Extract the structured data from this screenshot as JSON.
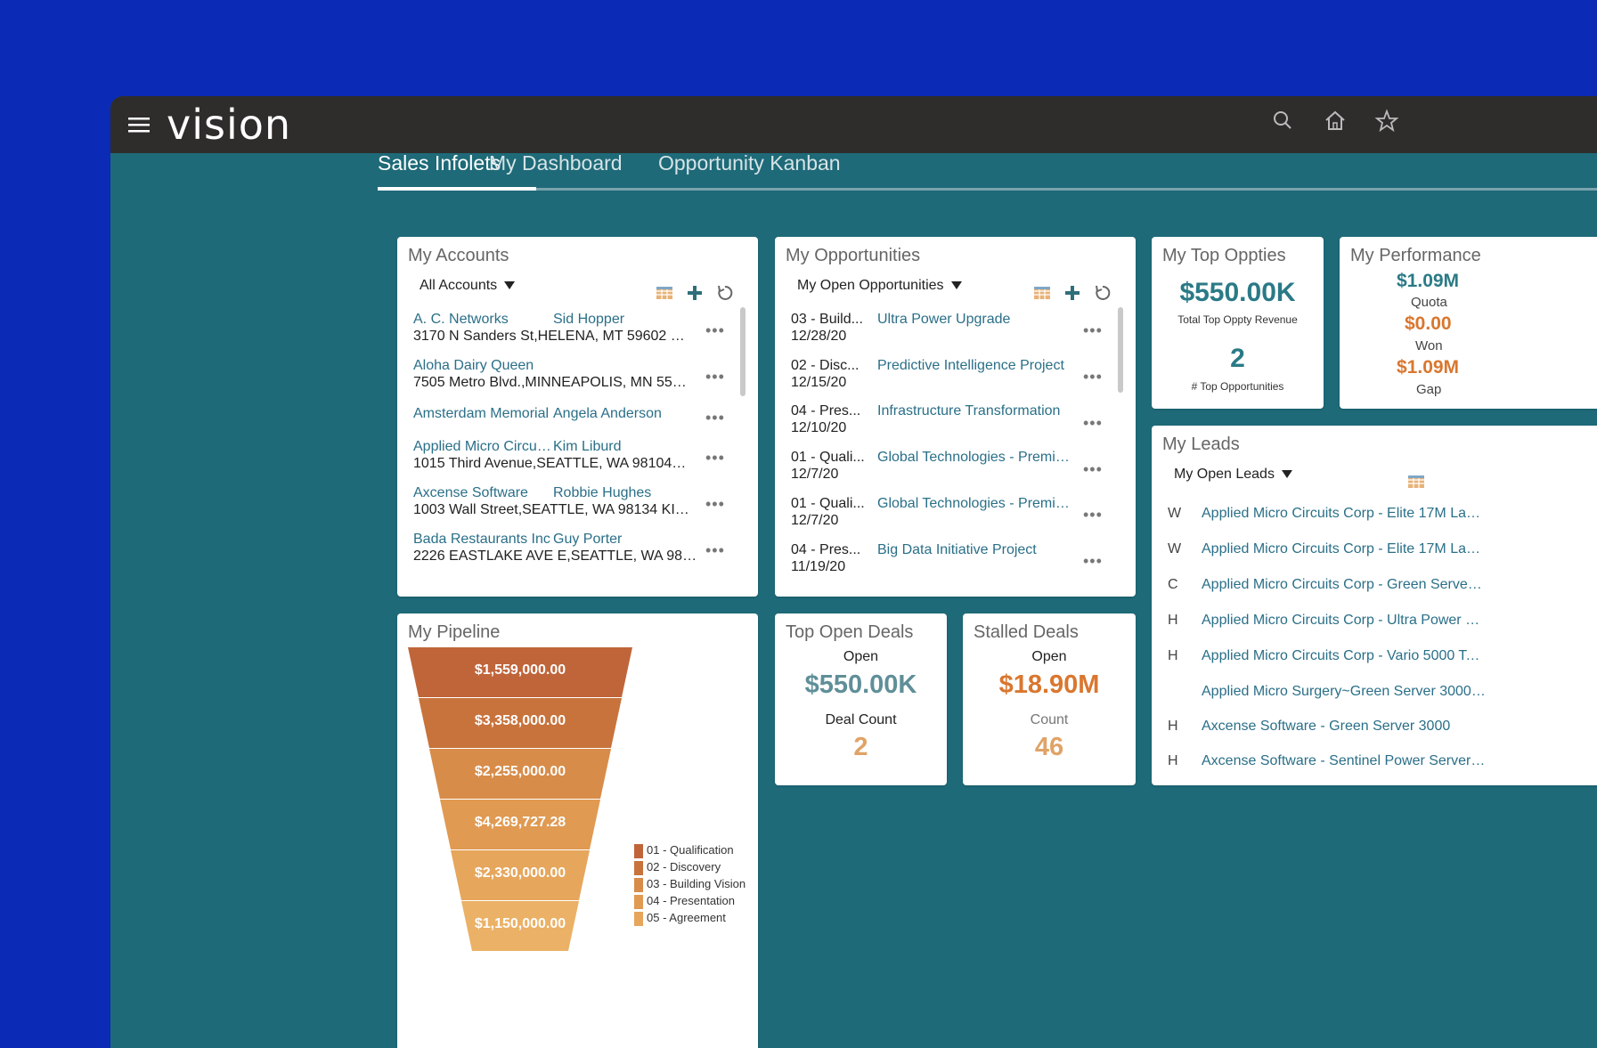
{
  "app": {
    "logo": "vision"
  },
  "tabs": [
    {
      "label": "Sales Infolets",
      "active": true
    },
    {
      "label": "My Dashboard",
      "active": false
    },
    {
      "label": "Opportunity Kanban",
      "active": false
    }
  ],
  "accounts": {
    "title": "My Accounts",
    "filter": "All Accounts",
    "rows": [
      {
        "name": "A. C. Networks",
        "contact": "Sid Hopper",
        "address": "3170 N Sanders St,HELENA, MT 59602 LEWIS A..."
      },
      {
        "name": "Aloha Dairy Queen",
        "contact": "",
        "address": "7505 Metro Blvd.,MINNEAPOLIS, MN 55439 Was..."
      },
      {
        "name": "Amsterdam Memorial",
        "contact": "Angela Anderson",
        "address": ""
      },
      {
        "name": "Applied Micro Circui...",
        "contact": "Kim Liburd",
        "address": "1015 Third Avenue,SEATTLE, WA 98104 KING"
      },
      {
        "name": "Axcense Software",
        "contact": "Robbie Hughes",
        "address": "1003 Wall Street,SEATTLE, WA 98134 KING"
      },
      {
        "name": "Bada Restaurants Inc",
        "contact": "Guy Porter",
        "address": "2226 EASTLAKE AVE E,SEATTLE, WA 98102 KING"
      }
    ]
  },
  "opportunities": {
    "title": "My Opportunities",
    "filter": "My Open Opportunities",
    "rows": [
      {
        "stage": "03 - Build...",
        "date": "12/28/20",
        "name": "Ultra Power Upgrade"
      },
      {
        "stage": "02 - Disc...",
        "date": "12/15/20",
        "name": "Predictive Intelligence Project"
      },
      {
        "stage": "04 - Pres...",
        "date": "12/10/20",
        "name": "Infrastructure Transformation"
      },
      {
        "stage": "01 - Quali...",
        "date": "12/7/20",
        "name": "Global Technologies - Premier Su..."
      },
      {
        "stage": "01 - Quali...",
        "date": "12/7/20",
        "name": "Global Technologies - Premier 24/..."
      },
      {
        "stage": "04 - Pres...",
        "date": "11/19/20",
        "name": "Big Data Initiative Project"
      }
    ]
  },
  "top_oppties": {
    "title": "My Top Oppties",
    "revenue": "$550.00K",
    "revenue_label": "Total Top Oppty Revenue",
    "count": "2",
    "count_label": "# Top Opportunities"
  },
  "performance": {
    "title": "My Performance",
    "quota_value": "$1.09M",
    "quota_label": "Quota",
    "won_value": "$0.00",
    "won_label": "Won",
    "gap_value": "$1.09M",
    "gap_label": "Gap"
  },
  "leads": {
    "title": "My Leads",
    "filter": "My Open Leads",
    "rows": [
      {
        "initial": "W",
        "name": "Applied Micro Circuits Corp - Elite 17M Lapt..."
      },
      {
        "initial": "W",
        "name": "Applied Micro Circuits Corp - Elite 17M Lapt..."
      },
      {
        "initial": "C",
        "name": "Applied Micro Circuits Corp - Green Server ..."
      },
      {
        "initial": "H",
        "name": "Applied Micro Circuits Corp - Ultra Power S..."
      },
      {
        "initial": "H",
        "name": "Applied Micro Circuits Corp - Vario 5000 Tab..."
      },
      {
        "initial": "",
        "name": "Applied Micro Surgery~Green Server 3000~..."
      },
      {
        "initial": "H",
        "name": "Axcense Software - Green Server 3000"
      },
      {
        "initial": "H",
        "name": "Axcense Software - Sentinel Power Server 3..."
      }
    ]
  },
  "top_open_deals": {
    "title": "Top Open Deals",
    "status": "Open",
    "value": "$550.00K",
    "count_label": "Deal Count",
    "count": "2"
  },
  "stalled_deals": {
    "title": "Stalled Deals",
    "status": "Open",
    "value": "$18.90M",
    "count_label": "Count",
    "count": "46"
  },
  "pipeline": {
    "title": "My Pipeline",
    "stages": [
      {
        "value": "$1,559,000.00",
        "color": "#c0653a"
      },
      {
        "value": "$3,358,000.00",
        "color": "#c8733c"
      },
      {
        "value": "$2,255,000.00",
        "color": "#d88c49"
      },
      {
        "value": "$4,269,727.28",
        "color": "#e09a52"
      },
      {
        "value": "$2,330,000.00",
        "color": "#e6a65c"
      },
      {
        "value": "$1,150,000.00",
        "color": "#ebb166"
      }
    ],
    "legend": [
      {
        "label": "01 - Qualification",
        "color": "#c0653a"
      },
      {
        "label": "02 - Discovery",
        "color": "#c8733c"
      },
      {
        "label": "03 - Building Vision",
        "color": "#d88c49"
      },
      {
        "label": "04 - Presentation",
        "color": "#e09a52"
      },
      {
        "label": "05 - Agreement",
        "color": "#e6a65c"
      }
    ]
  },
  "colors": {
    "accent_teal": "#1e6a78",
    "metric_teal": "#2a7a86",
    "metric_orange": "#d9772f",
    "link": "#2a6f88"
  }
}
